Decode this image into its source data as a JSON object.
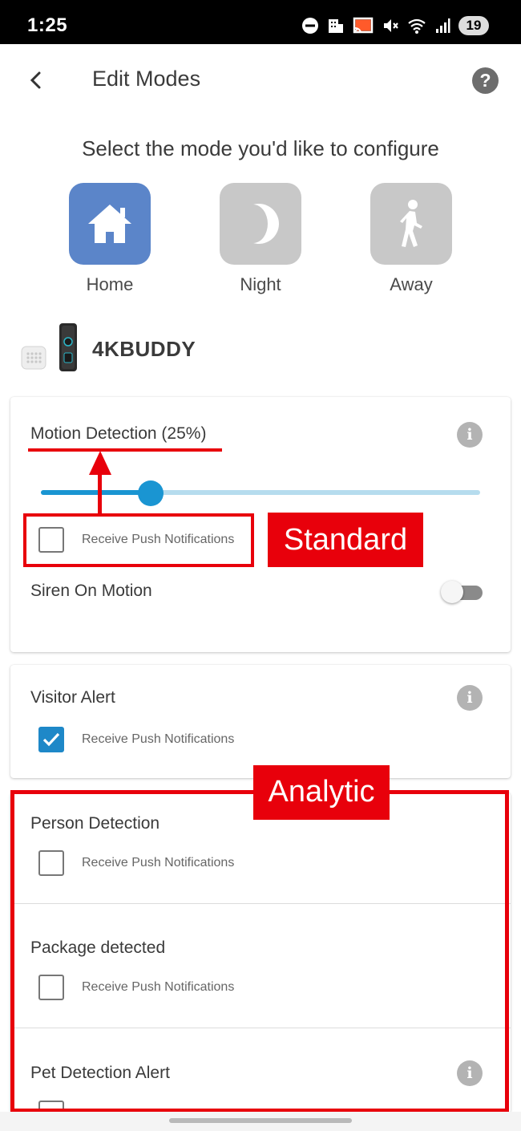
{
  "status_bar": {
    "time": "1:25",
    "battery": "19",
    "icons": [
      "do-not-disturb-icon",
      "app-notification-icon",
      "cast-icon",
      "mute-icon",
      "wifi-icon",
      "signal-icon"
    ]
  },
  "header": {
    "title": "Edit Modes",
    "back_icon": "chevron-left-icon",
    "help_label": "?"
  },
  "mode_selector": {
    "title": "Select the mode you'd like to configure",
    "modes": [
      {
        "label": "Home",
        "icon": "house-icon",
        "active": true
      },
      {
        "label": "Night",
        "icon": "moon-icon",
        "active": false
      },
      {
        "label": "Away",
        "icon": "walking-person-icon",
        "active": false
      }
    ],
    "active_color": "#5b85c9",
    "inactive_color": "#c8c8c8"
  },
  "device": {
    "name": "4KBUDDY"
  },
  "motion_card": {
    "title": "Motion Detection (25%)",
    "info_label": "i",
    "sensitivity_percent": 25,
    "push_label": "Receive Push Notifications",
    "push_checked": false,
    "siren_label": "Siren On Motion",
    "siren_on": false
  },
  "visitor_card": {
    "title": "Visitor Alert",
    "info_label": "i",
    "push_label": "Receive Push Notifications",
    "push_checked": true
  },
  "analytic_cards": [
    {
      "title": "Person Detection",
      "push_label": "Receive Push Notifications",
      "push_checked": false
    },
    {
      "title": "Package detected",
      "push_label": "Receive Push Notifications",
      "push_checked": false
    },
    {
      "title": "Pet Detection Alert",
      "info_label": "i",
      "push_checked": false
    }
  ],
  "annotations": {
    "standard_label": "Standard",
    "analytic_label": "Analytic",
    "color": "#e8000b"
  },
  "colors": {
    "accent": "#1a95d2",
    "slider_track": "#b6dcee"
  }
}
